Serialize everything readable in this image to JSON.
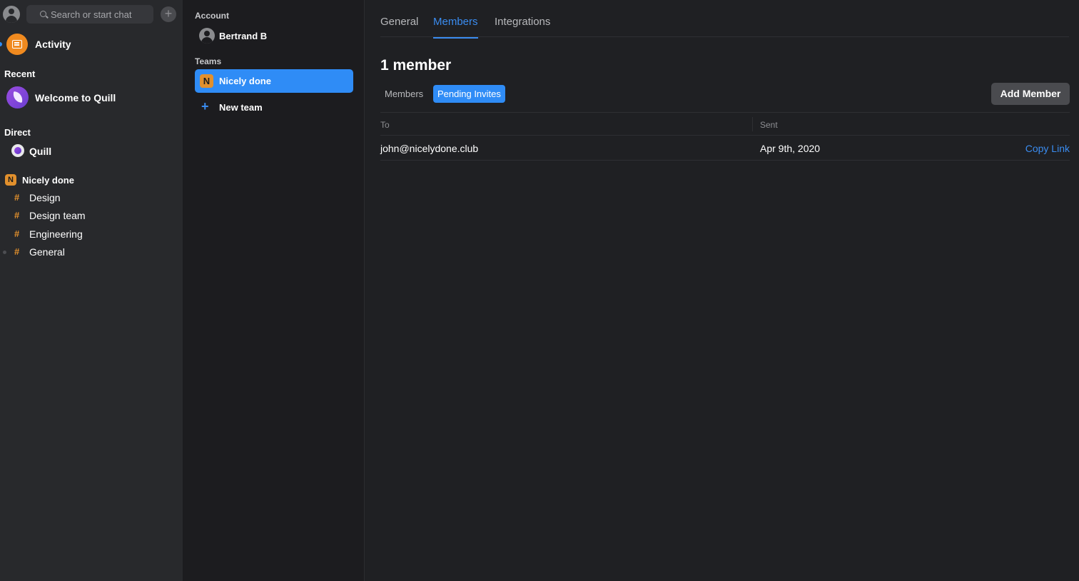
{
  "sidebar": {
    "search_placeholder": "Search or start chat",
    "activity_label": "Activity",
    "recent_heading": "Recent",
    "recent_items": [
      {
        "label": "Welcome to Quill"
      }
    ],
    "direct_heading": "Direct",
    "direct_items": [
      {
        "label": "Quill"
      }
    ],
    "team": {
      "badge": "N",
      "name": "Nicely done",
      "channels": [
        {
          "label": "Design"
        },
        {
          "label": "Design team"
        },
        {
          "label": "Engineering"
        },
        {
          "label": "General"
        }
      ]
    }
  },
  "settings_nav": {
    "account_heading": "Account",
    "account_name": "Bertrand B",
    "teams_heading": "Teams",
    "selected_team": {
      "badge": "N",
      "label": "Nicely done"
    },
    "new_team_label": "New team"
  },
  "main": {
    "tabs": [
      {
        "label": "General"
      },
      {
        "label": "Members"
      },
      {
        "label": "Integrations"
      }
    ],
    "member_count": "1 member",
    "subtabs": [
      {
        "label": "Members"
      },
      {
        "label": "Pending Invites"
      }
    ],
    "add_member_label": "Add Member",
    "table": {
      "headers": {
        "to": "To",
        "sent": "Sent"
      },
      "rows": [
        {
          "to": "john@nicelydone.club",
          "sent": "Apr 9th, 2020",
          "action": "Copy Link"
        }
      ]
    }
  },
  "colors": {
    "accent": "#2f8cf6",
    "team_badge": "#e2902d",
    "activity_icon": "#f08a1f"
  }
}
